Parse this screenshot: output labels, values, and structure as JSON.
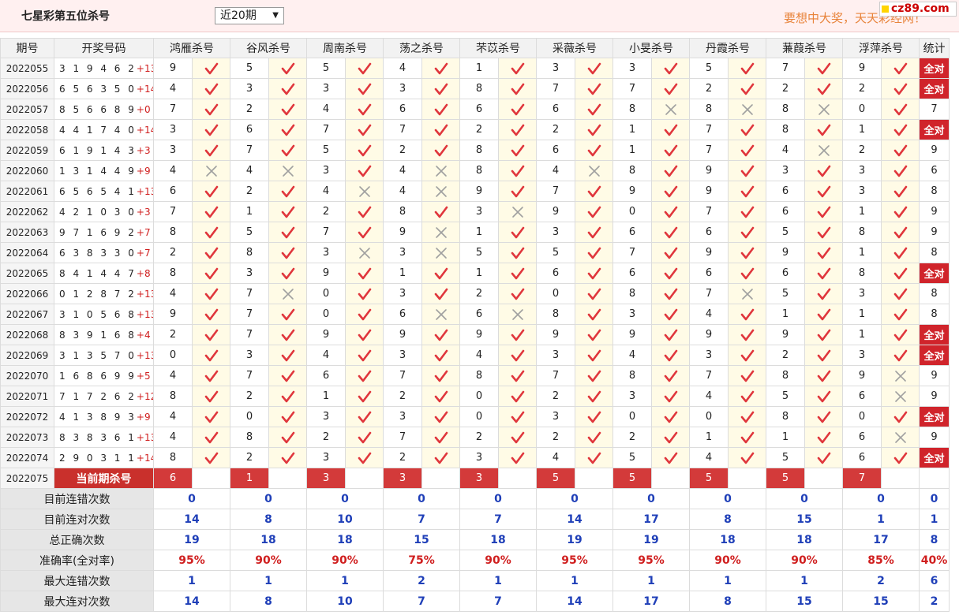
{
  "header": {
    "title": "七星彩第五位杀号",
    "period_select": "近20期",
    "slogan": "要想中大奖，天天彩经网！",
    "logo": "cz89.com"
  },
  "columns": {
    "issue": "期号",
    "draw": "开奖号码",
    "stat": "统计"
  },
  "experts": [
    "鸿雁杀号",
    "谷风杀号",
    "周南杀号",
    "荡之杀号",
    "芣苡杀号",
    "采薇杀号",
    "小旻杀号",
    "丹霞杀号",
    "蒹葭杀号",
    "浮萍杀号"
  ],
  "rows": [
    {
      "issue": "2022055",
      "digits": "3 1 9 4 6 2",
      "sum": "+13",
      "kills": [
        9,
        5,
        5,
        4,
        1,
        3,
        3,
        5,
        7,
        9
      ],
      "marks": "1111111111",
      "stat": "全对"
    },
    {
      "issue": "2022056",
      "digits": "6 5 6 3 5 0",
      "sum": "+14",
      "kills": [
        4,
        3,
        3,
        3,
        8,
        7,
        7,
        2,
        2,
        2
      ],
      "marks": "1111111111",
      "stat": "全对"
    },
    {
      "issue": "2022057",
      "digits": "8 5 6 6 8 9",
      "sum": "+0",
      "kills": [
        7,
        2,
        4,
        6,
        6,
        6,
        8,
        8,
        8,
        0
      ],
      "marks": "1111110001",
      "stat": "7"
    },
    {
      "issue": "2022058",
      "digits": "4 4 1 7 4 0",
      "sum": "+14",
      "kills": [
        3,
        6,
        7,
        7,
        2,
        2,
        1,
        7,
        8,
        1
      ],
      "marks": "1111111111",
      "stat": "全对"
    },
    {
      "issue": "2022059",
      "digits": "6 1 9 1 4 3",
      "sum": "+3",
      "kills": [
        3,
        7,
        5,
        2,
        8,
        6,
        1,
        7,
        4,
        2
      ],
      "marks": "1111111101",
      "stat": "9"
    },
    {
      "issue": "2022060",
      "digits": "1 3 1 4 4 9",
      "sum": "+9",
      "kills": [
        4,
        4,
        3,
        4,
        8,
        4,
        8,
        9,
        3,
        3
      ],
      "marks": "0010101111",
      "stat": "6"
    },
    {
      "issue": "2022061",
      "digits": "6 5 6 5 4 1",
      "sum": "+13",
      "kills": [
        6,
        2,
        4,
        4,
        9,
        7,
        9,
        9,
        6,
        3
      ],
      "marks": "1100111111",
      "stat": "8"
    },
    {
      "issue": "2022062",
      "digits": "4 2 1 0 3 0",
      "sum": "+3",
      "kills": [
        7,
        1,
        2,
        8,
        3,
        9,
        0,
        7,
        6,
        1
      ],
      "marks": "1111011111",
      "stat": "9"
    },
    {
      "issue": "2022063",
      "digits": "9 7 1 6 9 2",
      "sum": "+7",
      "kills": [
        8,
        5,
        7,
        9,
        1,
        3,
        6,
        6,
        5,
        8
      ],
      "marks": "1110111111",
      "stat": "9"
    },
    {
      "issue": "2022064",
      "digits": "6 3 8 3 3 0",
      "sum": "+7",
      "kills": [
        2,
        8,
        3,
        3,
        5,
        5,
        7,
        9,
        9,
        1
      ],
      "marks": "1100111111",
      "stat": "8"
    },
    {
      "issue": "2022065",
      "digits": "8 4 1 4 4 7",
      "sum": "+8",
      "kills": [
        8,
        3,
        9,
        1,
        1,
        6,
        6,
        6,
        6,
        8
      ],
      "marks": "1111111111",
      "stat": "全对"
    },
    {
      "issue": "2022066",
      "digits": "0 1 2 8 7 2",
      "sum": "+13",
      "kills": [
        4,
        7,
        0,
        3,
        2,
        0,
        8,
        7,
        5,
        3
      ],
      "marks": "1011111011",
      "stat": "8"
    },
    {
      "issue": "2022067",
      "digits": "3 1 0 5 6 8",
      "sum": "+13",
      "kills": [
        9,
        7,
        0,
        6,
        6,
        8,
        3,
        4,
        1,
        1
      ],
      "marks": "1110011111",
      "stat": "8"
    },
    {
      "issue": "2022068",
      "digits": "8 3 9 1 6 8",
      "sum": "+4",
      "kills": [
        2,
        7,
        9,
        9,
        9,
        9,
        9,
        9,
        9,
        1
      ],
      "marks": "1111111111",
      "stat": "全对"
    },
    {
      "issue": "2022069",
      "digits": "3 1 3 5 7 0",
      "sum": "+13",
      "kills": [
        0,
        3,
        4,
        3,
        4,
        3,
        4,
        3,
        2,
        3
      ],
      "marks": "1111111111",
      "stat": "全对"
    },
    {
      "issue": "2022070",
      "digits": "1 6 8 6 9 9",
      "sum": "+5",
      "kills": [
        4,
        7,
        6,
        7,
        8,
        7,
        8,
        7,
        8,
        9
      ],
      "marks": "1111111110",
      "stat": "9"
    },
    {
      "issue": "2022071",
      "digits": "7 1 7 2 6 2",
      "sum": "+12",
      "kills": [
        8,
        2,
        1,
        2,
        0,
        2,
        3,
        4,
        5,
        6
      ],
      "marks": "1111111110",
      "stat": "9"
    },
    {
      "issue": "2022072",
      "digits": "4 1 3 8 9 3",
      "sum": "+9",
      "kills": [
        4,
        0,
        3,
        3,
        0,
        3,
        0,
        0,
        8,
        0
      ],
      "marks": "1111111111",
      "stat": "全对"
    },
    {
      "issue": "2022073",
      "digits": "8 3 8 3 6 1",
      "sum": "+13",
      "kills": [
        4,
        8,
        2,
        7,
        2,
        2,
        2,
        1,
        1,
        6
      ],
      "marks": "1111111110",
      "stat": "9"
    },
    {
      "issue": "2022074",
      "digits": "2 9 0 3 1 1",
      "sum": "+14",
      "kills": [
        8,
        2,
        3,
        2,
        3,
        4,
        5,
        4,
        5,
        6
      ],
      "marks": "1111111111",
      "stat": "全对"
    }
  ],
  "current": {
    "issue": "2022075",
    "label": "当前期杀号",
    "kills": [
      6,
      1,
      3,
      3,
      3,
      5,
      5,
      5,
      5,
      7
    ]
  },
  "summary": [
    {
      "label": "目前连错次数",
      "values": [
        "0",
        "0",
        "0",
        "0",
        "0",
        "0",
        "0",
        "0",
        "0",
        "0"
      ],
      "stat": "0",
      "pct": false
    },
    {
      "label": "目前连对次数",
      "values": [
        "14",
        "8",
        "10",
        "7",
        "7",
        "14",
        "17",
        "8",
        "15",
        "1"
      ],
      "stat": "1",
      "pct": false
    },
    {
      "label": "总正确次数",
      "values": [
        "19",
        "18",
        "18",
        "15",
        "18",
        "19",
        "19",
        "18",
        "18",
        "17"
      ],
      "stat": "8",
      "pct": false
    },
    {
      "label": "准确率(全对率)",
      "values": [
        "95%",
        "90%",
        "90%",
        "75%",
        "90%",
        "95%",
        "95%",
        "90%",
        "90%",
        "85%"
      ],
      "stat": "40%",
      "pct": true
    },
    {
      "label": "最大连错次数",
      "values": [
        "1",
        "1",
        "1",
        "2",
        "1",
        "1",
        "1",
        "1",
        "1",
        "2"
      ],
      "stat": "6",
      "pct": false
    },
    {
      "label": "最大连对次数",
      "values": [
        "14",
        "8",
        "10",
        "7",
        "7",
        "14",
        "17",
        "8",
        "15",
        "15"
      ],
      "stat": "2",
      "pct": false
    }
  ],
  "colors": {
    "accent_red": "#d0242b",
    "check_red": "#e0363c",
    "cross_gray": "#a0a0a0",
    "summary_blue": "#1f3fb8"
  },
  "icons": {
    "right": "check-icon",
    "wrong": "cross-icon",
    "dropdown": "caret-down-icon"
  }
}
